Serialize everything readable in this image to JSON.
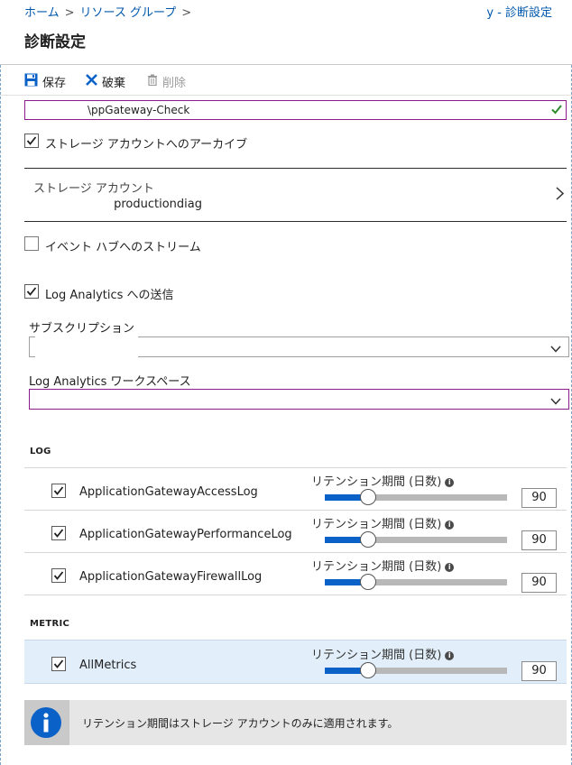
{
  "breadcrumb": {
    "home": "ホーム",
    "resource_group": "リソース グループ",
    "current": "y - 診断設定"
  },
  "page": {
    "title": "診断設定"
  },
  "toolbar": {
    "save_label": "保存",
    "discard_label": "破棄",
    "delete_label": "削除"
  },
  "name_field": {
    "value": "\\ppGateway-Check"
  },
  "archive": {
    "label": "ストレージ アカウントへのアーカイブ",
    "checked": true
  },
  "storage_account": {
    "label": "ストレージ アカウント",
    "value": "productiondiag"
  },
  "event_hub": {
    "label": "イベント ハブへのストリーム",
    "checked": false
  },
  "log_analytics": {
    "label": "Log Analytics への送信",
    "checked": true
  },
  "subscription": {
    "label": "サブスクリプション",
    "value": ""
  },
  "workspace": {
    "label": "Log Analytics ワークスペース",
    "value": ""
  },
  "log_section": {
    "title": "LOG",
    "retention_label": "リテンション期間 (日数)",
    "rows": [
      {
        "name": "ApplicationGatewayAccessLog",
        "checked": true,
        "retention": "90"
      },
      {
        "name": "ApplicationGatewayPerformanceLog",
        "checked": true,
        "retention": "90"
      },
      {
        "name": "ApplicationGatewayFirewallLog",
        "checked": true,
        "retention": "90"
      }
    ]
  },
  "metric_section": {
    "title": "METRIC",
    "retention_label": "リテンション期間 (日数)",
    "rows": [
      {
        "name": "AllMetrics",
        "checked": true,
        "retention": "90"
      }
    ]
  },
  "retention_slider_fraction": 0.24,
  "info_banner": {
    "text": "リテンション期間はストレージ アカウントのみに適用されます。"
  },
  "colors": {
    "accent": "#0058ad",
    "focus_border": "#8c1c8c",
    "slider": "#0a61c8",
    "check": "#1e6b2a"
  }
}
